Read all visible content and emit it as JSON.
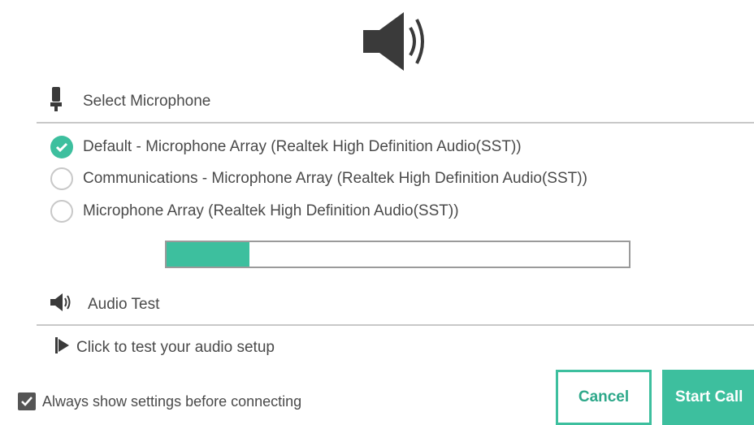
{
  "colors": {
    "accent": "#3dbf9e",
    "text": "#4a4a4a",
    "divider": "#c8c8c8"
  },
  "header": {
    "icon": "speaker-icon"
  },
  "microphone": {
    "section_label": "Select Microphone",
    "icon": "microphone-icon",
    "options": [
      {
        "label": "Default - Microphone Array (Realtek High Definition Audio(SST))",
        "selected": true
      },
      {
        "label": "Communications - Microphone Array (Realtek High Definition Audio(SST))",
        "selected": false
      },
      {
        "label": "Microphone Array (Realtek High Definition Audio(SST))",
        "selected": false
      }
    ],
    "level": 0.18
  },
  "audio_test": {
    "section_label": "Audio Test",
    "icon": "speaker-icon",
    "link_label": "Click to test your audio setup",
    "link_icon": "play-icon"
  },
  "settings": {
    "always_show_label": "Always show settings before connecting",
    "always_show_checked": true
  },
  "buttons": {
    "cancel": "Cancel",
    "start_call": "Start Call"
  }
}
